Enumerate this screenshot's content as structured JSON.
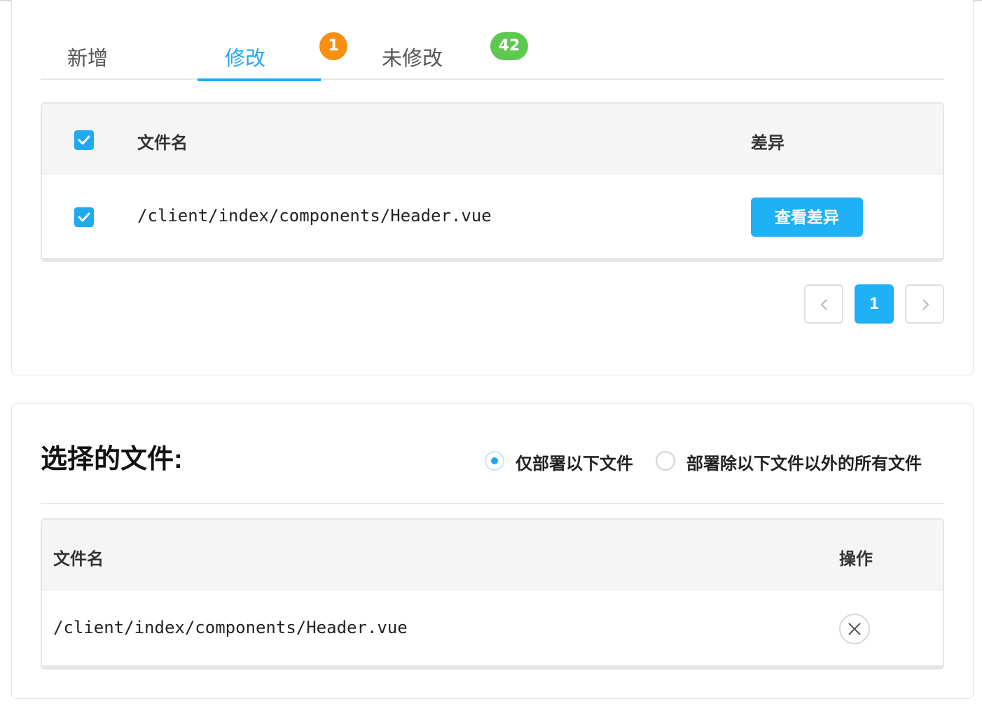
{
  "tabs": [
    {
      "label": "新增"
    },
    {
      "label": "修改",
      "badge": "1",
      "active": true
    },
    {
      "label": "未修改",
      "badge": "42"
    }
  ],
  "changed_table": {
    "columns": [
      "文件名",
      "差异"
    ],
    "rows": [
      {
        "file": "/client/index/components/Header.vue",
        "checked": true,
        "action_label": "查看差异"
      }
    ],
    "select_all_checked": true
  },
  "pagination": {
    "current_page": "1"
  },
  "selected_files": {
    "title": "选择的文件:",
    "deploy_modes": [
      {
        "label": "仅部署以下文件",
        "selected": true
      },
      {
        "label": "部署除以下文件以外的所有文件",
        "selected": false
      }
    ],
    "columns": [
      "文件名",
      "操作"
    ],
    "rows": [
      {
        "file": "/client/index/components/Header.vue"
      }
    ]
  },
  "colors": {
    "accent": "#1ea9f0",
    "badge_orange": "#f7900e",
    "badge_green": "#5dc94f"
  },
  "icons": [
    "check-icon",
    "chevron-left-icon",
    "chevron-right-icon",
    "close-icon"
  ]
}
